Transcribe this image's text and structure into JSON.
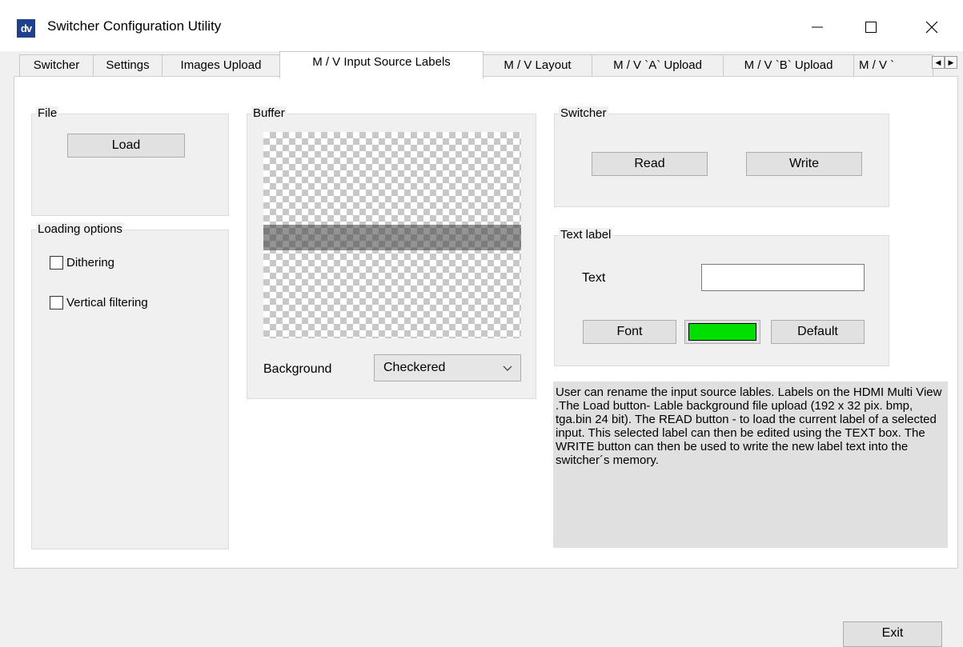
{
  "window": {
    "logo_text": "dv",
    "title": "Switcher Configuration Utility"
  },
  "tabs": [
    {
      "label": "Switcher",
      "active": false
    },
    {
      "label": "Settings",
      "active": false
    },
    {
      "label": "Images Upload",
      "active": false
    },
    {
      "label": "M / V  Input Source Labels",
      "active": true
    },
    {
      "label": "M / V Layout",
      "active": false
    },
    {
      "label": "M / V `A` Upload",
      "active": false
    },
    {
      "label": "M / V `B` Upload",
      "active": false
    },
    {
      "label": "M / V `",
      "active": false
    }
  ],
  "file_group": {
    "title": "File",
    "load_label": "Load"
  },
  "loading_options": {
    "title": "Loading options",
    "dithering_label": "Dithering",
    "dithering_checked": false,
    "vertical_filtering_label": "Vertical filtering",
    "vertical_filtering_checked": false
  },
  "buffer": {
    "title": "Buffer",
    "background_label": "Background",
    "background_value": "Checkered"
  },
  "switcher_group": {
    "title": "Switcher",
    "read_label": "Read",
    "write_label": "Write"
  },
  "text_label_group": {
    "title": "Text label",
    "text_label": "Text",
    "text_value": "",
    "font_label": "Font",
    "color": "#00e000",
    "default_label": "Default"
  },
  "help_text": "User can rename the input source lables. Labels on the HDMI Multi View .The Load button- Lable background file upload (192 x 32 pix. bmp, tga.bin 24 bit). The READ button - to load the current label of a selected input. This selected label can then be edited using the TEXT box. The WRITE button can then be used to write the new label text into the switcher´s memory.",
  "exit_label": "Exit"
}
